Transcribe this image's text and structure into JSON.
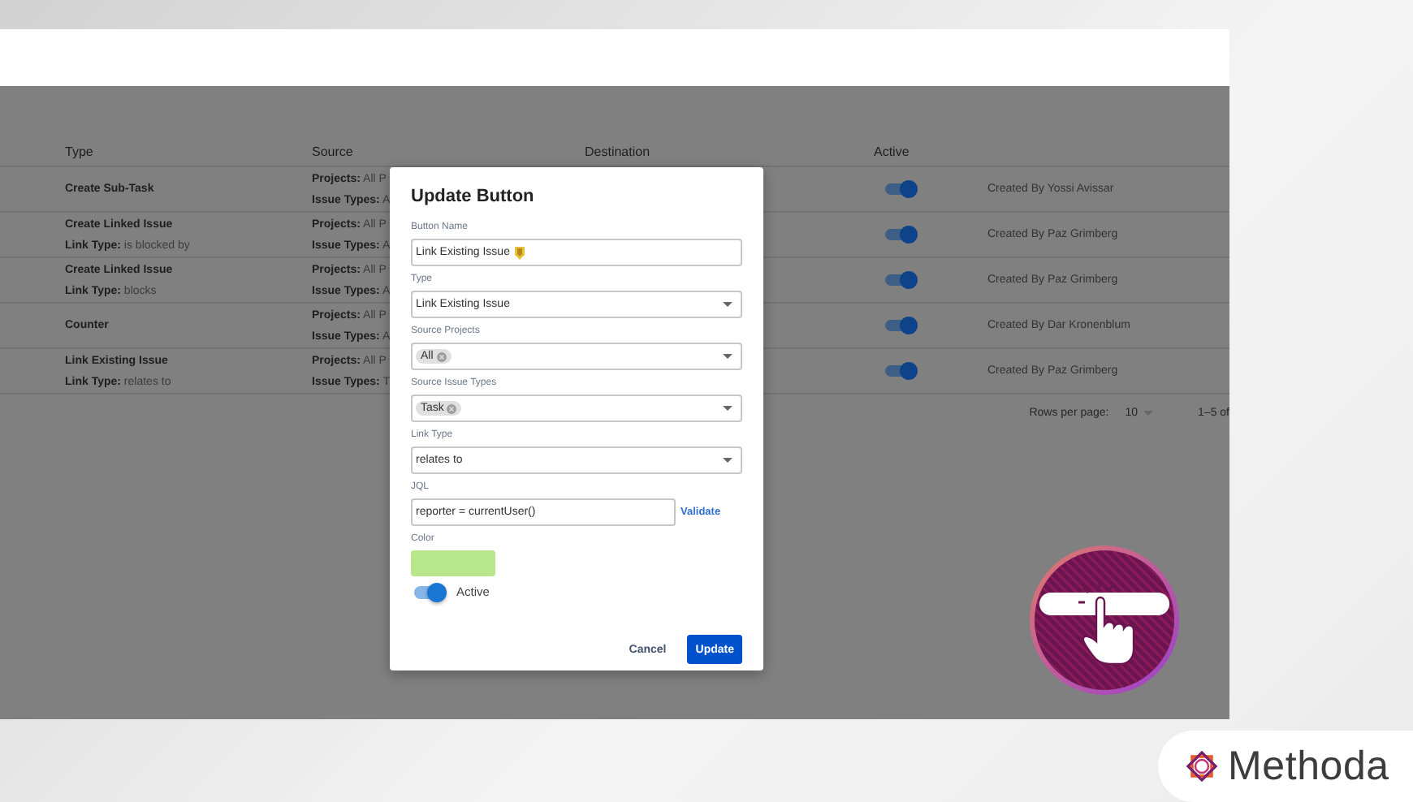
{
  "table": {
    "columns": [
      "Type",
      "Source",
      "Destination",
      "Active"
    ],
    "rows": [
      {
        "type": "Create Sub-Task",
        "source": [
          "**Projects:** All P",
          "**Issue Types:** A"
        ],
        "active": true,
        "created_by": "Created By Yossi Avissar"
      },
      {
        "type": "Create Linked Issue",
        "link": "**Link Type:** is blocked by",
        "source": [
          "**Projects:** All P",
          "**Issue Types:** A"
        ],
        "active": true,
        "created_by": "Created By Paz Grimberg"
      },
      {
        "type": "Create Linked Issue",
        "link": "**Link Type:** blocks",
        "source": [
          "**Projects:** All P",
          "**Issue Types:** A"
        ],
        "active": true,
        "created_by": "Created By Paz Grimberg"
      },
      {
        "type": "Counter",
        "source": [
          "**Projects:** All P",
          "**Issue Types:** A"
        ],
        "active": true,
        "created_by": "Created By Dar Kronenblum"
      },
      {
        "type": "Link Existing Issue",
        "link": "**Link Type:** relates to",
        "source": [
          "**Projects:** All P",
          "**Issue Types:** T"
        ],
        "active": true,
        "created_by": "Created By Paz Grimberg"
      }
    ],
    "pagination": {
      "label": "Rows per page:",
      "rows_per_page": "10",
      "range": "1–5 of"
    }
  },
  "dialog": {
    "title": "Update Button",
    "fields": [
      {
        "kind": "text",
        "label": "Button Name",
        "value": "Link Existing Issue"
      },
      {
        "kind": "select",
        "label": "Type",
        "value": "Link Existing Issue"
      },
      {
        "kind": "chips",
        "label": "Source Projects",
        "chips": [
          "All"
        ]
      },
      {
        "kind": "chips",
        "label": "Source Issue Types",
        "chips": [
          "Task"
        ]
      },
      {
        "kind": "select",
        "label": "Link Type",
        "value": "relates to"
      },
      {
        "kind": "jql",
        "label": "JQL",
        "value": "reporter = currentUser()",
        "link": "Validate"
      },
      {
        "kind": "color",
        "label": "Color",
        "color": "#b8e68a"
      },
      {
        "kind": "toggle",
        "label": "Active",
        "on": true
      }
    ],
    "buttons": [
      "Cancel",
      "Update"
    ]
  },
  "brand": {
    "name": "Methoda"
  }
}
